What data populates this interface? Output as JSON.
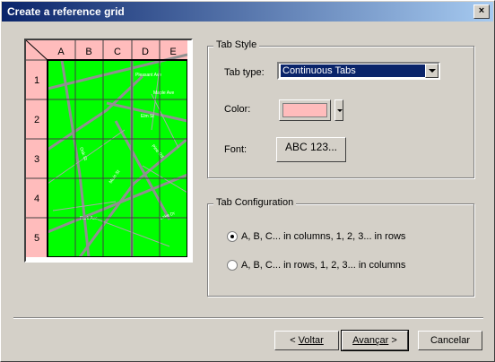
{
  "window": {
    "title": "Create a reference grid",
    "close": "×"
  },
  "preview": {
    "col_headers": [
      "A",
      "B",
      "C",
      "D",
      "E"
    ],
    "row_headers": [
      "1",
      "2",
      "3",
      "4",
      "5"
    ],
    "street_labels": [
      "Pleasant Ave",
      "Maple Ave",
      "Elm St",
      "Oak St",
      "Pine Rd",
      "Main St",
      "Park Ave",
      "Lake Dr"
    ]
  },
  "tab_style": {
    "group_label": "Tab Style",
    "tab_type_label": "Tab type:",
    "tab_type_value": "Continuous Tabs",
    "color_label": "Color:",
    "color_value": "#ffbcbc",
    "font_label": "Font:",
    "font_button": "ABC 123..."
  },
  "tab_config": {
    "group_label": "Tab Configuration",
    "option1": "A, B, C... in columns, 1, 2, 3... in rows",
    "option2": "A, B, C... in rows, 1, 2, 3... in columns",
    "selected": 1
  },
  "buttons": {
    "back": "Voltar",
    "back_prefix": "< ",
    "next": "Avançar",
    "next_suffix": " >",
    "cancel": "Cancelar"
  }
}
